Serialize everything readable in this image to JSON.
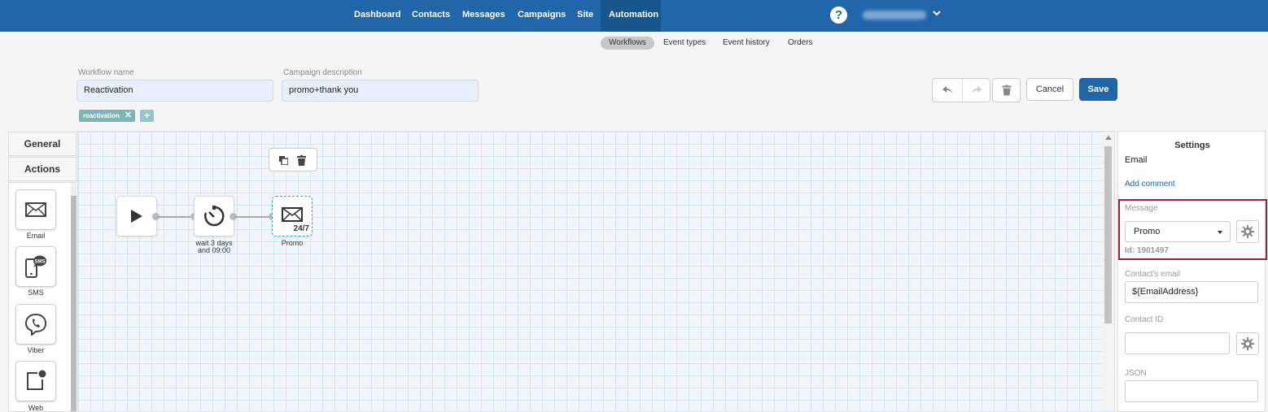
{
  "nav": {
    "items": [
      {
        "label": "Dashboard"
      },
      {
        "label": "Contacts"
      },
      {
        "label": "Messages"
      },
      {
        "label": "Campaigns"
      },
      {
        "label": "Site"
      },
      {
        "label": "Automation",
        "active": true
      }
    ],
    "help": "?"
  },
  "subtabs": [
    {
      "label": "Workflows",
      "active": true
    },
    {
      "label": "Event types"
    },
    {
      "label": "Event history"
    },
    {
      "label": "Orders"
    }
  ],
  "form": {
    "workflow_name_label": "Workflow name",
    "workflow_name_value": "Reactivation",
    "campaign_desc_label": "Campaign description",
    "campaign_desc_value": "promo+thank you",
    "tag": "reactivation",
    "tag_remove": "✕",
    "tag_add": "+"
  },
  "toolbar": {
    "cancel": "Cancel",
    "save": "Save"
  },
  "left_panel": {
    "tabs": [
      "General",
      "Actions"
    ],
    "actions": [
      {
        "label": "Email",
        "icon": "email-icon"
      },
      {
        "label": "SMS",
        "icon": "sms-icon",
        "badge": "SMS"
      },
      {
        "label": "Viber",
        "icon": "viber-icon"
      },
      {
        "label": "Web",
        "icon": "web-push-icon"
      }
    ]
  },
  "workflow": {
    "nodes": [
      {
        "type": "start",
        "icon": "play-icon",
        "label": ""
      },
      {
        "type": "wait",
        "icon": "timer-icon",
        "label_line1": "wait 3 days",
        "label_line2": "and 09:00"
      },
      {
        "type": "email",
        "icon": "email-icon",
        "badge": "24/7",
        "label": "Promo",
        "selected": true
      }
    ]
  },
  "settings": {
    "title": "Settings",
    "subtitle": "Email",
    "add_comment": "Add comment",
    "message_label": "Message",
    "message_value": "Promo",
    "message_id": "Id: 1901497",
    "contact_email_label": "Contact's email",
    "contact_email_value": "${EmailAddress}",
    "contact_id_label": "Contact ID",
    "contact_id_value": "",
    "json_label": "JSON",
    "json_value": ""
  },
  "colors": {
    "nav_bg": "#2166a8",
    "accent": "#2166a8",
    "highlight": "#a0223a",
    "tag_bg": "#7fb3b8"
  }
}
